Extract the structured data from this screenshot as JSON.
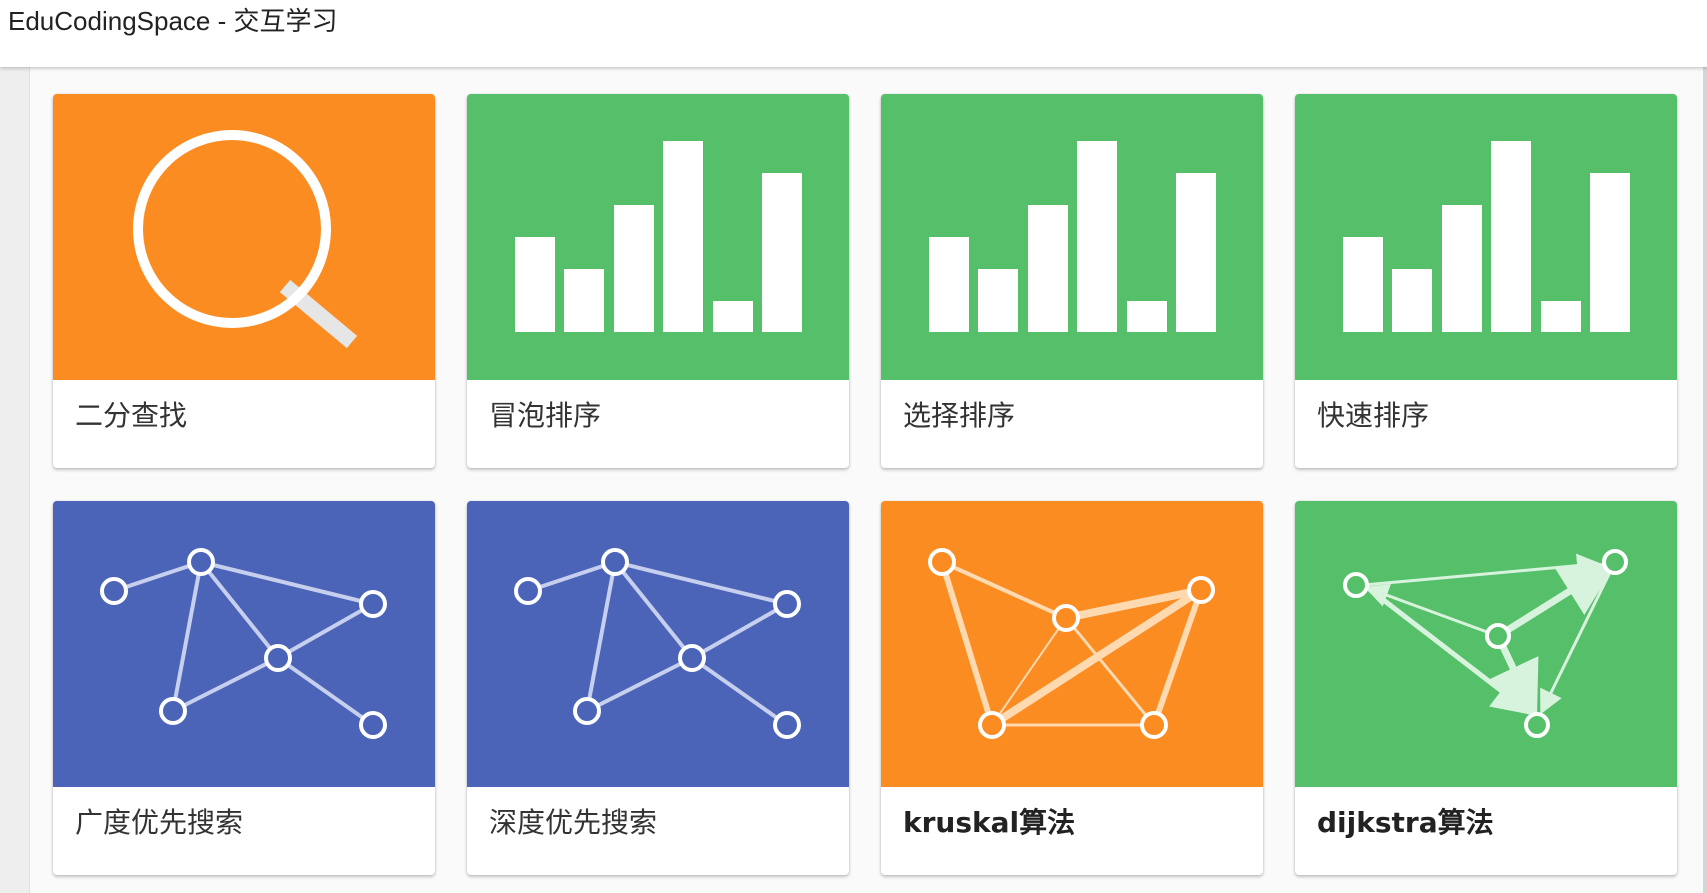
{
  "window": {
    "title": "EduCodingSpace - 交互学习"
  },
  "colors": {
    "orange": "#fa8c22",
    "green": "#55bf69",
    "blue": "#4b64b8"
  },
  "cards": [
    {
      "label": "二分查找",
      "icon": "magnifier-icon",
      "color": "orange"
    },
    {
      "label": "冒泡排序",
      "icon": "bar-chart-icon",
      "color": "green"
    },
    {
      "label": "选择排序",
      "icon": "bar-chart-icon",
      "color": "green"
    },
    {
      "label": "快速排序",
      "icon": "bar-chart-icon",
      "color": "green"
    },
    {
      "label": "广度优先搜索",
      "icon": "graph-icon",
      "color": "blue"
    },
    {
      "label": "深度优先搜索",
      "icon": "graph-icon",
      "color": "blue"
    },
    {
      "label": "kruskal算法",
      "icon": "weighted-graph-icon",
      "color": "orange"
    },
    {
      "label": "dijkstra算法",
      "icon": "directed-graph-icon",
      "color": "green"
    }
  ]
}
